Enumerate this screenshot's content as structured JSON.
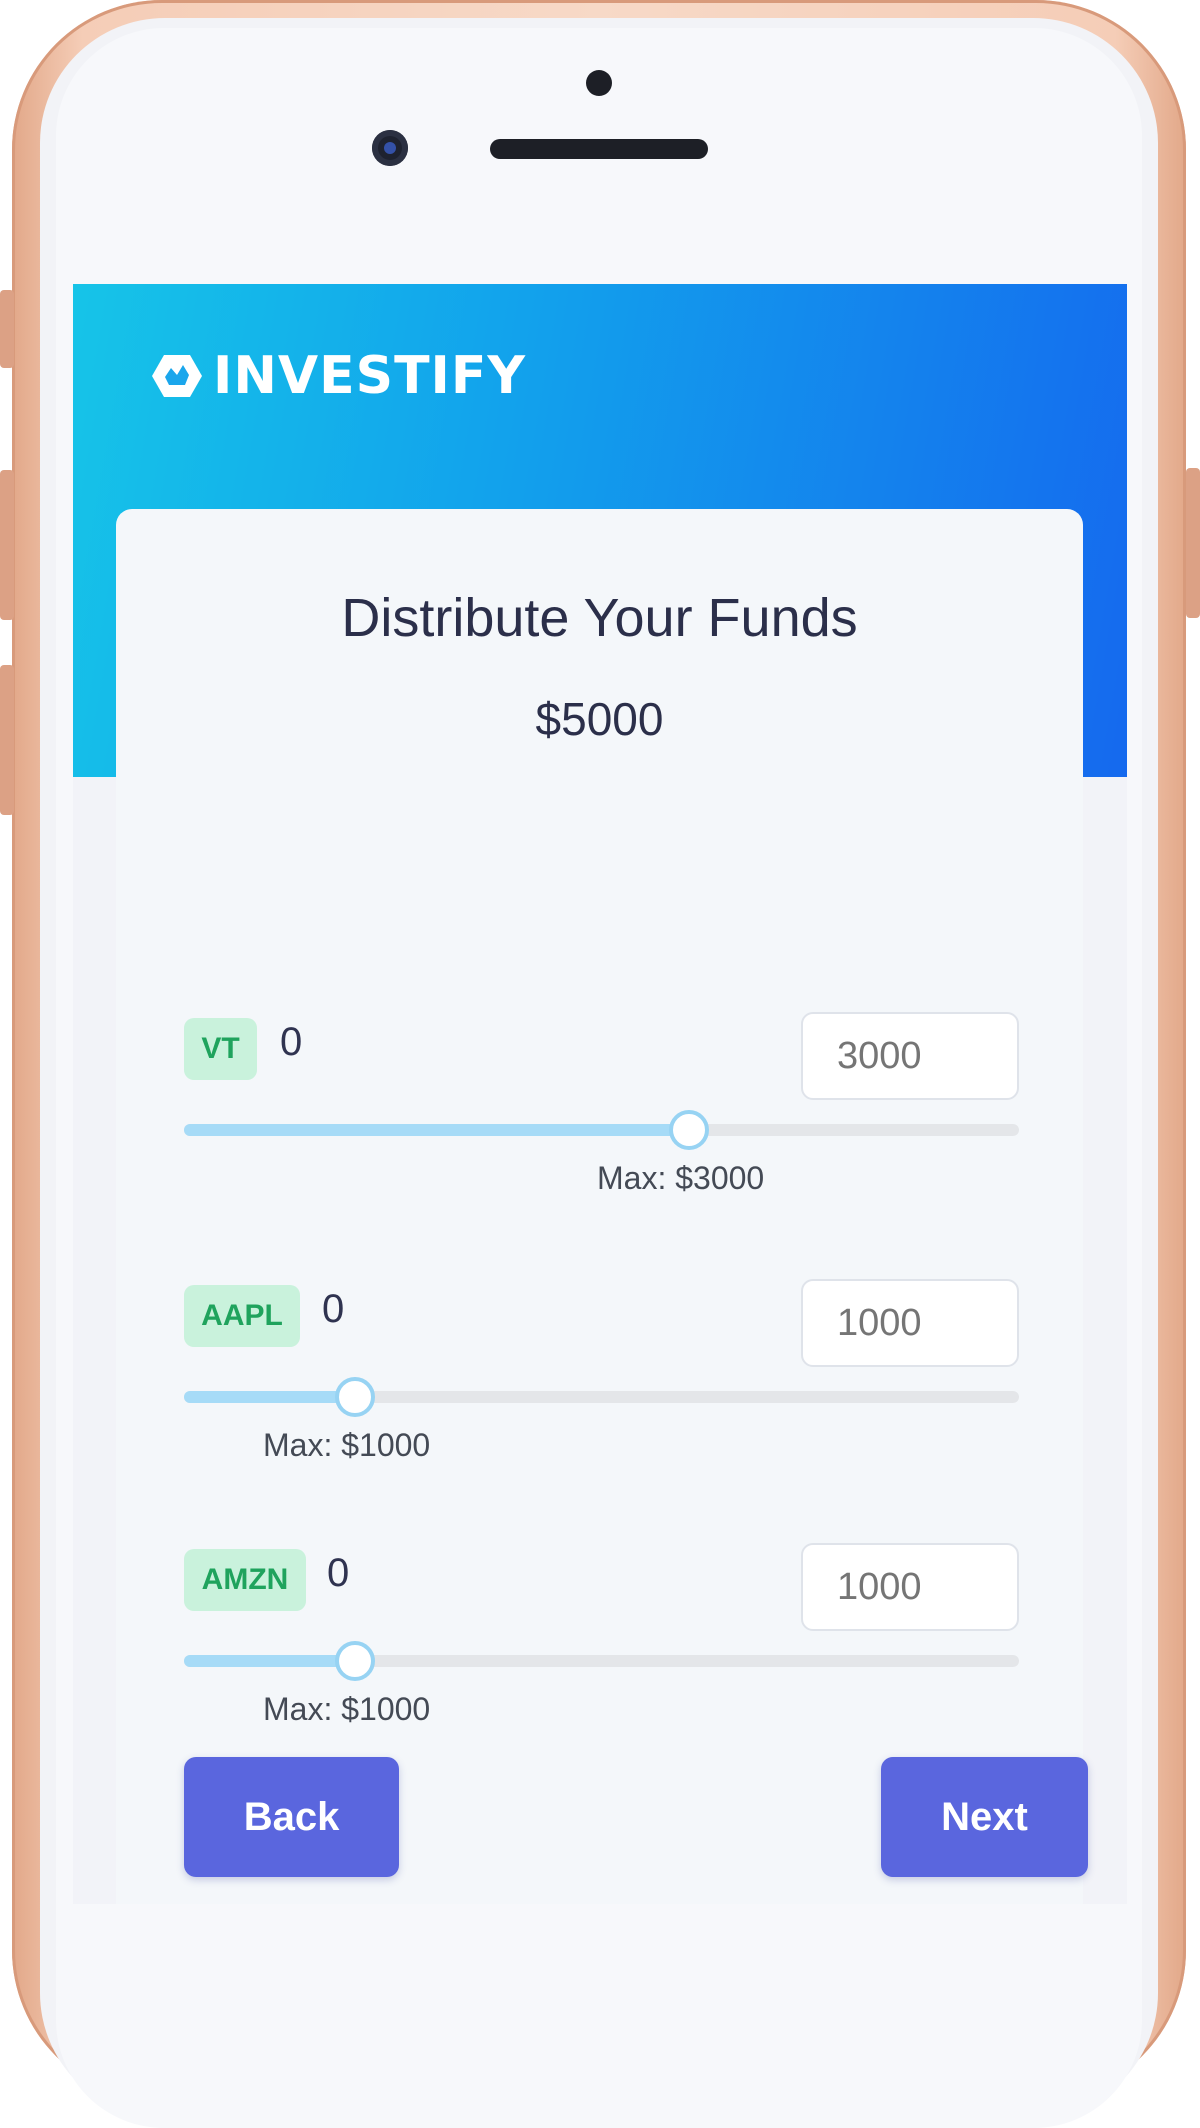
{
  "app": {
    "logo_text": "INVESTIFY"
  },
  "card": {
    "title": "Distribute Your Funds",
    "total": "$5000"
  },
  "funds": [
    {
      "ticker": "VT",
      "amount": "0",
      "input_value": "3000",
      "slider_fraction": 0.6,
      "max_label": "Max: $3000"
    },
    {
      "ticker": "AAPL",
      "amount": "0",
      "input_value": "1000",
      "slider_fraction": 0.2,
      "max_label": "Max: $1000"
    },
    {
      "ticker": "AMZN",
      "amount": "0",
      "input_value": "1000",
      "slider_fraction": 0.2,
      "max_label": "Max: $1000"
    }
  ],
  "buttons": {
    "back_label": "Back",
    "next_label": "Next"
  },
  "colors": {
    "header_gradient_start": "#16c4e8",
    "header_gradient_end": "#1569ee",
    "button": "#5a66de",
    "badge_bg": "#c9f2dc",
    "badge_text": "#1fa35d",
    "slider_fill": "#a6dbf7"
  },
  "icons": {
    "logo": "investify-logo-icon"
  }
}
